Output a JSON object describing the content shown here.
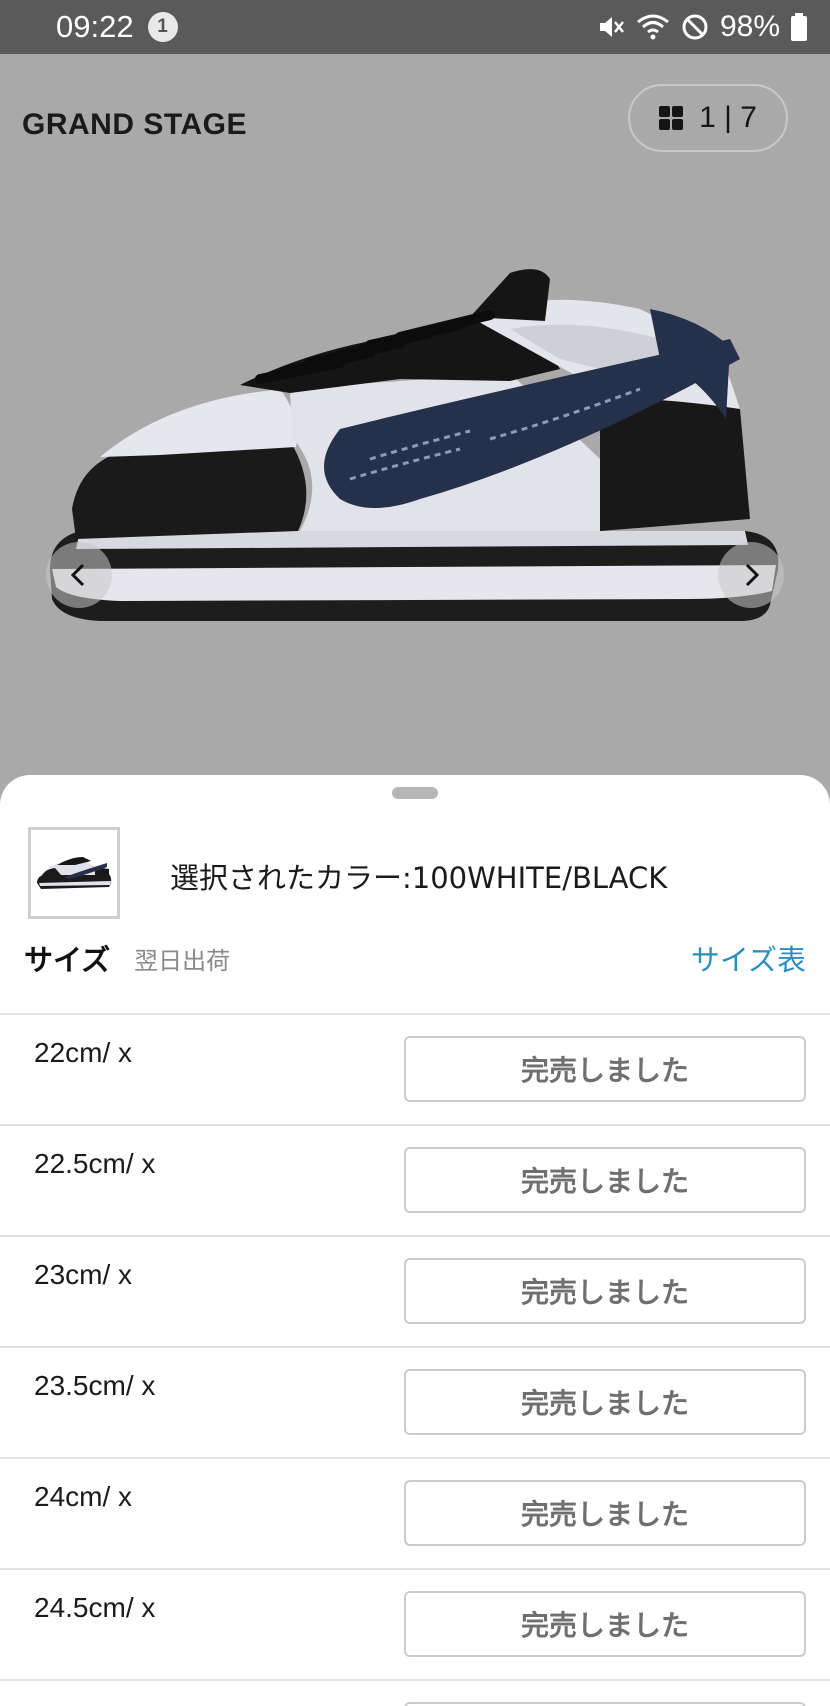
{
  "status_bar": {
    "time": "09:22",
    "notification_count": "1",
    "battery": "98%"
  },
  "brand": {
    "name": "GRAND STAGE"
  },
  "gallery": {
    "current": "1",
    "total": "7",
    "counter_text": "1 | 7"
  },
  "sheet": {
    "selected_color": "選択されたカラー:100WHITE/BLACK",
    "size_title": "サイズ",
    "shipping_note": "翌日出荷",
    "size_chart_link": "サイズ表",
    "sizes": [
      {
        "label": "22cm/ x",
        "button": "完売しました"
      },
      {
        "label": "22.5cm/ x",
        "button": "完売しました"
      },
      {
        "label": "23cm/ x",
        "button": "完売しました"
      },
      {
        "label": "23.5cm/ x",
        "button": "完売しました"
      },
      {
        "label": "24cm/ x",
        "button": "完売しました"
      },
      {
        "label": "24.5cm/ x",
        "button": "完売しました"
      },
      {
        "label": "",
        "button": ""
      }
    ]
  },
  "colors": {
    "status_bar_bg": "#5a5a5a",
    "overlay_bg": "#a9a9a9",
    "link": "#2a8fbd",
    "soldout_text": "#6f6f6f"
  },
  "icons": [
    "grid-icon",
    "chevron-left-icon",
    "chevron-right-icon",
    "mute-icon",
    "wifi-icon",
    "dnd-icon",
    "battery-icon"
  ]
}
